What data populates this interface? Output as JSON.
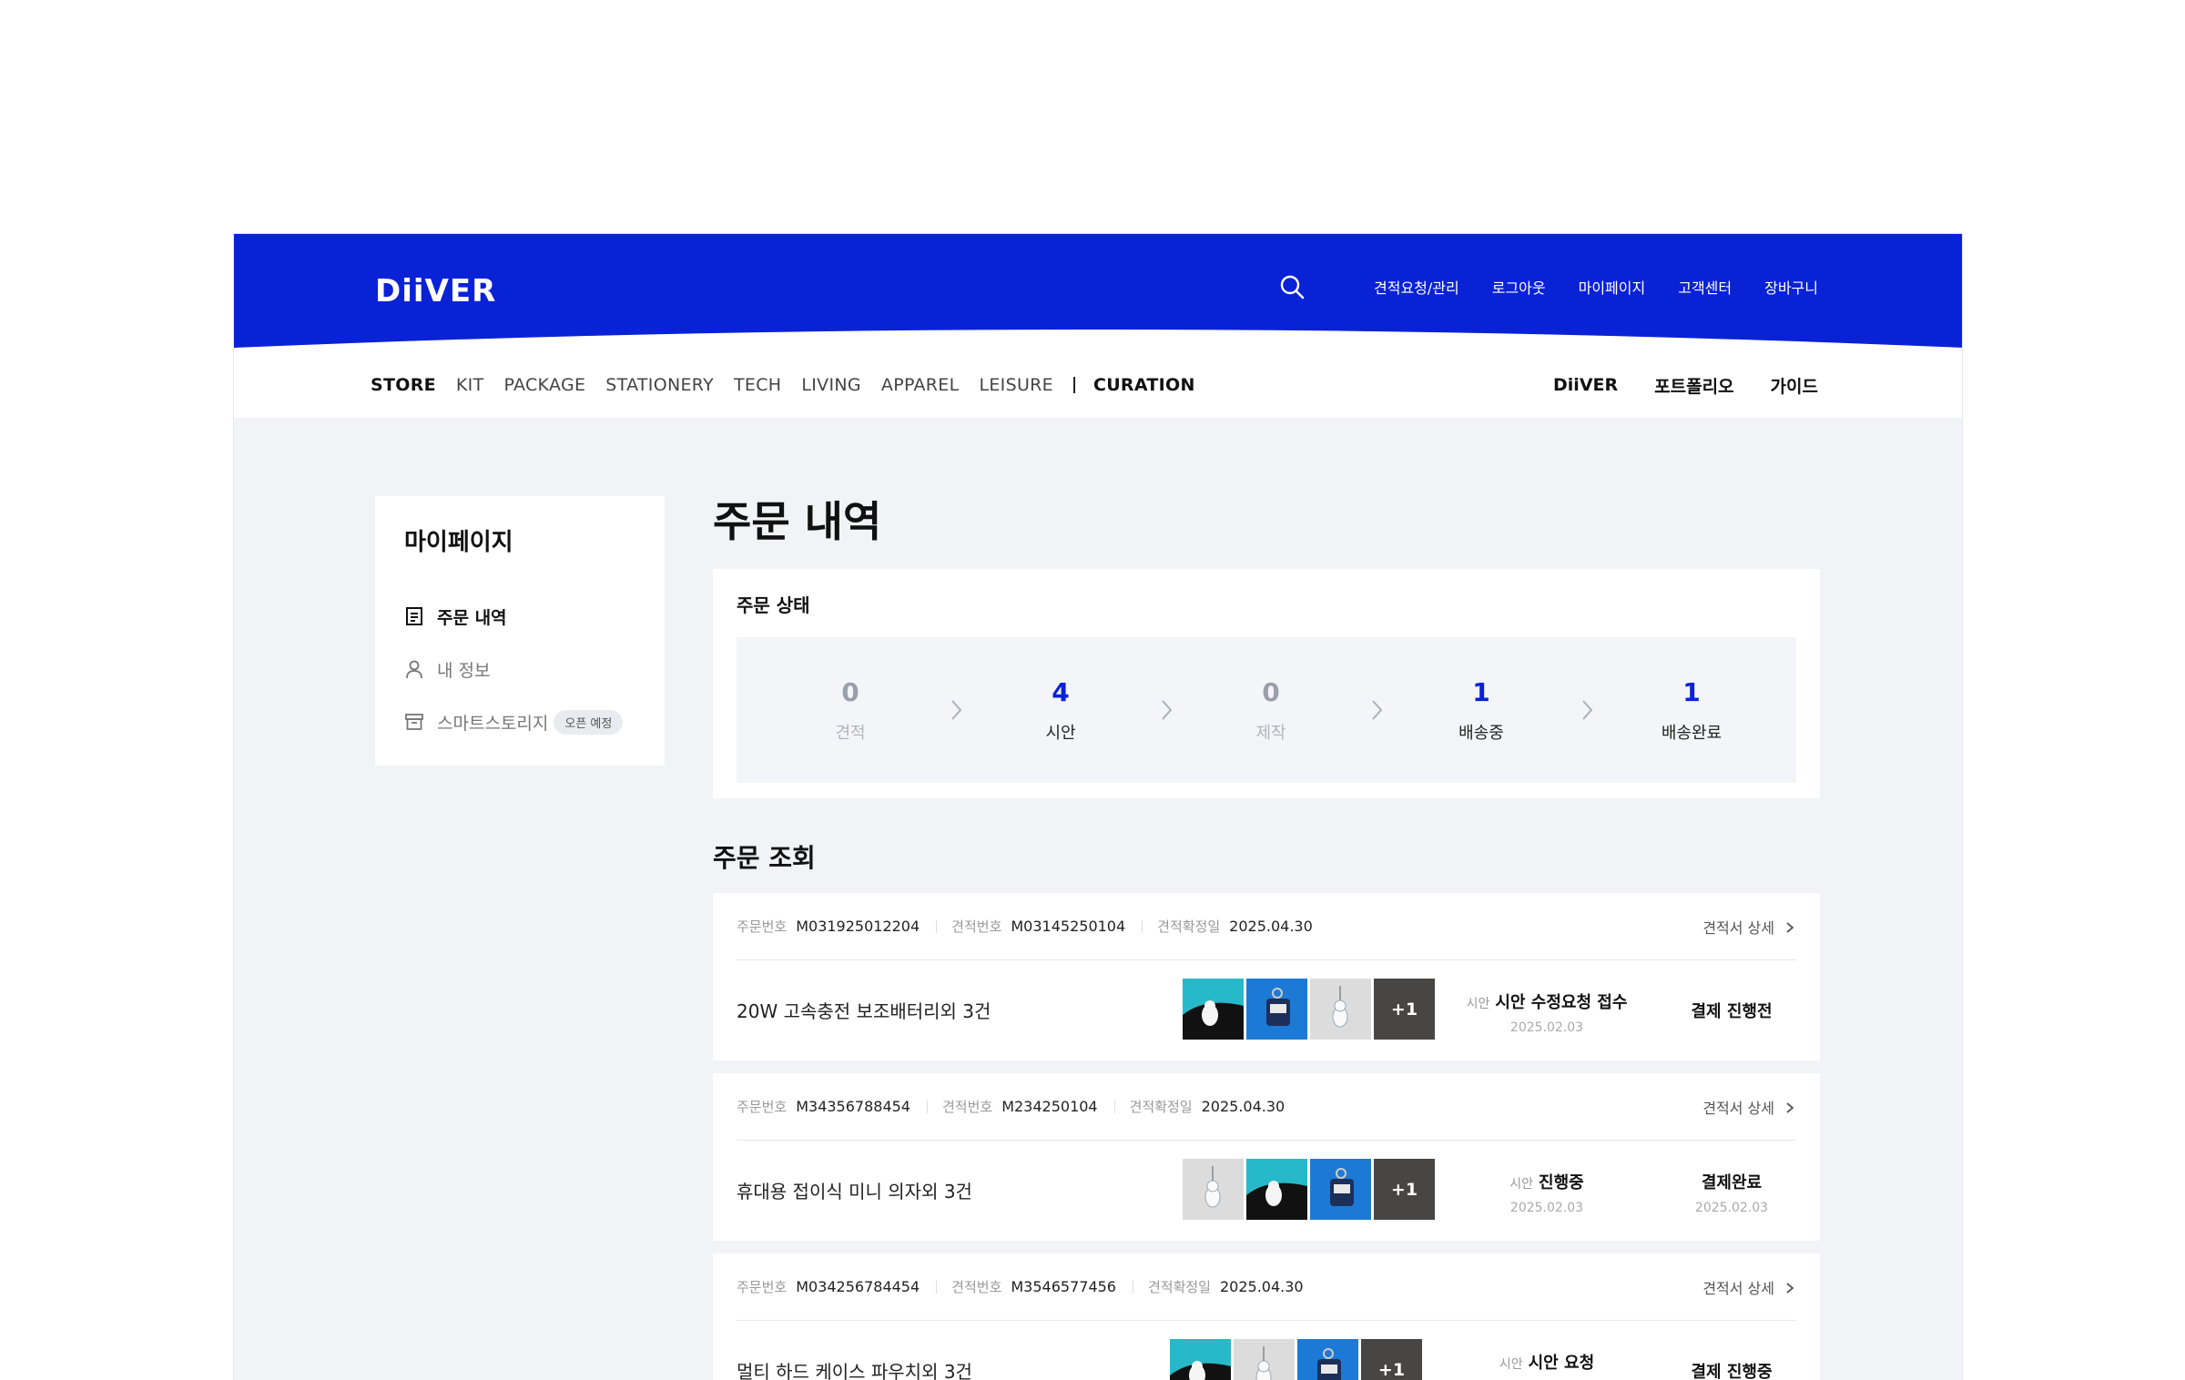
{
  "header": {
    "logo": "DiiVER",
    "util_links": [
      "견적요청/관리",
      "로그아웃",
      "마이페이지",
      "고객센터",
      "장바구니"
    ],
    "brand_color": "#0a22d6"
  },
  "category_nav": {
    "items": [
      "STORE",
      "KIT",
      "PACKAGE",
      "STATIONERY",
      "TECH",
      "LIVING",
      "APPAREL",
      "LEISURE"
    ],
    "curation": "CURATION",
    "right_links": [
      "DiiVER",
      "포트폴리오",
      "가이드"
    ]
  },
  "sidebar": {
    "title": "마이페이지",
    "items": [
      {
        "label": "주문 내역",
        "icon": "document-icon"
      },
      {
        "label": "내 정보",
        "icon": "user-icon"
      },
      {
        "label": "스마트스토리지",
        "icon": "archive-icon",
        "badge": "오픈 예정"
      }
    ]
  },
  "main": {
    "title": "주문 내역",
    "status_card": {
      "title": "주문 상태",
      "stages": [
        {
          "count": "0",
          "label": "견적"
        },
        {
          "count": "4",
          "label": "시안"
        },
        {
          "count": "0",
          "label": "제작"
        },
        {
          "count": "1",
          "label": "배송중"
        },
        {
          "count": "1",
          "label": "배송완료"
        }
      ]
    },
    "lookup_title": "주문 조회",
    "meta_labels": {
      "order_no": "주문번호",
      "quote_no": "견적번호",
      "confirm_date": "견적확정일",
      "detail": "견적서 상세",
      "proof": "시안"
    },
    "orders": [
      {
        "order_no": "M031925012204",
        "quote_no": "M03145250104",
        "confirm_date": "2025.04.30",
        "product": "20W 고속충전 보조배터리외 3건",
        "more": "+1",
        "proof_status": "시안 수정요청 접수",
        "proof_date": "2025.02.03",
        "pay_status": "결제 진행전",
        "pay_date": ""
      },
      {
        "order_no": "M34356788454",
        "quote_no": "M234250104",
        "confirm_date": "2025.04.30",
        "product": "휴대용 접이식 미니 의자외 3건",
        "more": "+1",
        "proof_status": "진행중",
        "proof_date": "2025.02.03",
        "pay_status": "결제완료",
        "pay_date": "2025.02.03"
      },
      {
        "order_no": "M034256784454",
        "quote_no": "M3546577456",
        "confirm_date": "2025.04.30",
        "product": "멀티 하드 케이스 파우치외 3건",
        "more": "+1",
        "proof_status": "시안 요청",
        "proof_date": "",
        "pay_status": "결제 진행중",
        "pay_date": ""
      }
    ]
  }
}
